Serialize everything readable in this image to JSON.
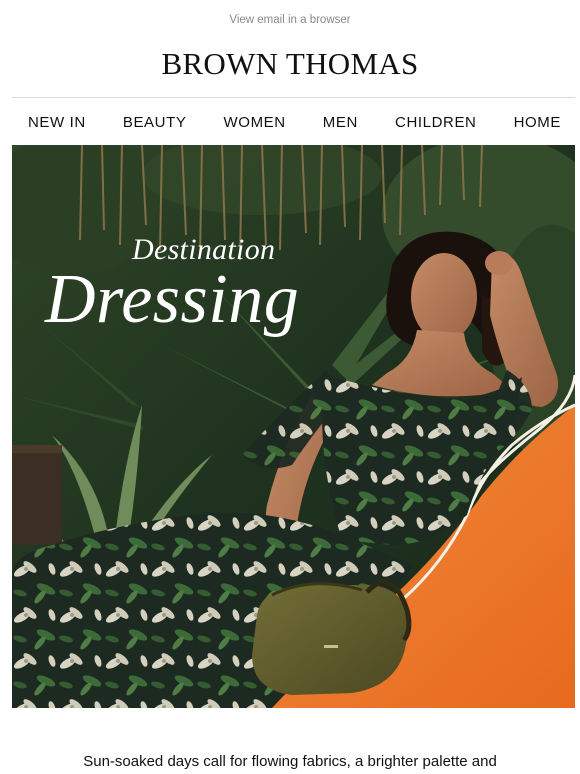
{
  "header": {
    "view_in_browser": "View email in a browser",
    "brand": "BROWN THOMAS"
  },
  "nav": {
    "items": [
      {
        "label": "NEW IN"
      },
      {
        "label": "BEAUTY"
      },
      {
        "label": "WOMEN"
      },
      {
        "label": "MEN"
      },
      {
        "label": "CHILDREN"
      },
      {
        "label": "HOME"
      }
    ]
  },
  "hero": {
    "headline_line1": "Destination",
    "headline_line2": "Dressing",
    "colors": {
      "foliage": "#223621",
      "lounger": "#ee7a2c",
      "dress_base": "#1d2a22",
      "print_leaf": "#3f6a3a",
      "print_flower": "#d9d6c6",
      "skin": "#b07a5a",
      "bag": "#5e5a2c"
    }
  },
  "body": {
    "intro_text": "Sun-soaked days call for flowing fabrics, a brighter palette and"
  }
}
